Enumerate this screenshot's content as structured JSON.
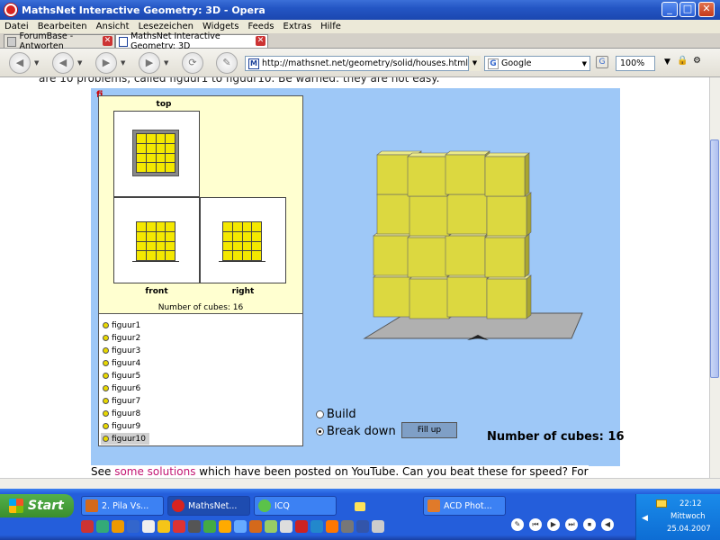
{
  "window": {
    "title": "MathsNet Interactive Geometry: 3D - Opera",
    "min": "_",
    "max": "□",
    "close": "✕"
  },
  "menu": [
    "Datei",
    "Bearbeiten",
    "Ansicht",
    "Lesezeichen",
    "Widgets",
    "Feeds",
    "Extras",
    "Hilfe"
  ],
  "tabs": [
    {
      "label": "ForumBase - Antworten",
      "close": "✕"
    },
    {
      "label": "MathsNet Interactive Geometry: 3D",
      "close": "✕"
    }
  ],
  "toolbar": {
    "back": "◀",
    "forward": "▶",
    "reload": "⟳",
    "address": "http://mathsnet.net/geometry/solid/houses.html",
    "search_engine": "Google",
    "zoom": "100%",
    "address_dropdown": "▼",
    "favicon_letter": "M",
    "search_icon_letter": "G"
  },
  "page": {
    "top_text": "are 10 problems, called figuur1 to figuur10. Be warned: they are not easy.",
    "views": {
      "top": "top",
      "front": "front",
      "right": "right",
      "count_label": "Number of cubes: 16"
    },
    "figures": [
      "figuur1",
      "figuur2",
      "figuur3",
      "figuur4",
      "figuur5",
      "figuur6",
      "figuur7",
      "figuur8",
      "figuur9",
      "figuur10"
    ],
    "selected_figure": "figuur10",
    "radio_build": "Build",
    "radio_breakdown": "Break down",
    "selected_mode": "Break down",
    "fill_up": "Fill up",
    "cube_count": "Number of cubes: 16",
    "bottom_before": "See ",
    "bottom_link": "some solutions",
    "bottom_after": " which have been posted on YouTube. Can you beat these for speed? For",
    "applet_badge": "fi"
  },
  "taskbar": {
    "start": "Start",
    "tasks": [
      "2. Pila Vs...",
      "MathsNet...",
      "ICQ",
      "ACD Phot..."
    ],
    "time": "22:12",
    "day": "Mittwoch",
    "date": "25.04.2007"
  },
  "colors": {
    "applet_bg": "#9ec8f7",
    "cube_face": "#dcd840",
    "views_bg": "#ffffd0",
    "taskbar": "#245edb"
  }
}
